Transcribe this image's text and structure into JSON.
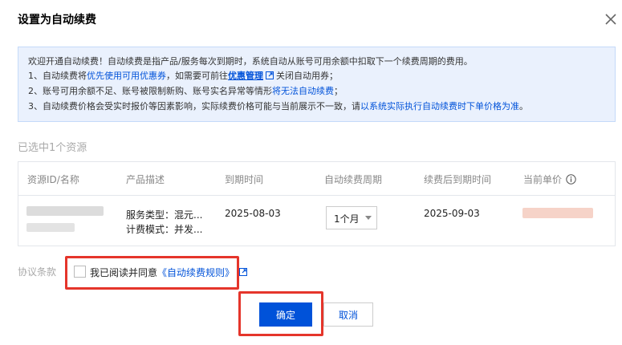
{
  "dialog": {
    "title": "设置为自动续费",
    "close_icon": "close-icon"
  },
  "notice": {
    "line1": "欢迎开通自动续费！自动续费是指产品/服务每次到期时，系统自动从账号可用余额中扣取下一个续费周期的费用。",
    "line2_pre": "1、自动续费将",
    "line2_link": "优先使用可用优惠券",
    "line2_mid": "，如需要可前往",
    "line2_bold_link": "优惠管理",
    "line2_post": "关闭自动用券；",
    "line3_pre": "2、账号可用余额不足、账号被限制新购、账号实名异常等情形",
    "line3_link": "将无法自动续费",
    "line3_post": "；",
    "line4_pre": "3、自动续费价格会受实时报价等因素影响，实际续费价格可能与当前展示不一致，请",
    "line4_link": "以系统实际执行自动续费时下单价格为准",
    "line4_post": "。"
  },
  "selection": {
    "count_text": "已选中1个资源"
  },
  "table": {
    "columns": [
      "资源ID/名称",
      "产品描述",
      "到期时间",
      "自动续费周期",
      "续费后到期时间",
      "当前单价"
    ],
    "row": {
      "desc_line1": "服务类型：混元...",
      "desc_line2": "计费模式：并发...",
      "expire": "2025-08-03",
      "period": "1个月",
      "renew_expire": "2025-09-03"
    }
  },
  "agreement": {
    "label": "协议条款",
    "text_pre": "我已阅读并同意",
    "rule_link": "《自动续费规则》"
  },
  "buttons": {
    "confirm": "确定",
    "cancel": "取消"
  },
  "colors": {
    "accent": "#0052d9",
    "highlight": "#e5352b",
    "notice_bg": "#eaf1fd"
  }
}
